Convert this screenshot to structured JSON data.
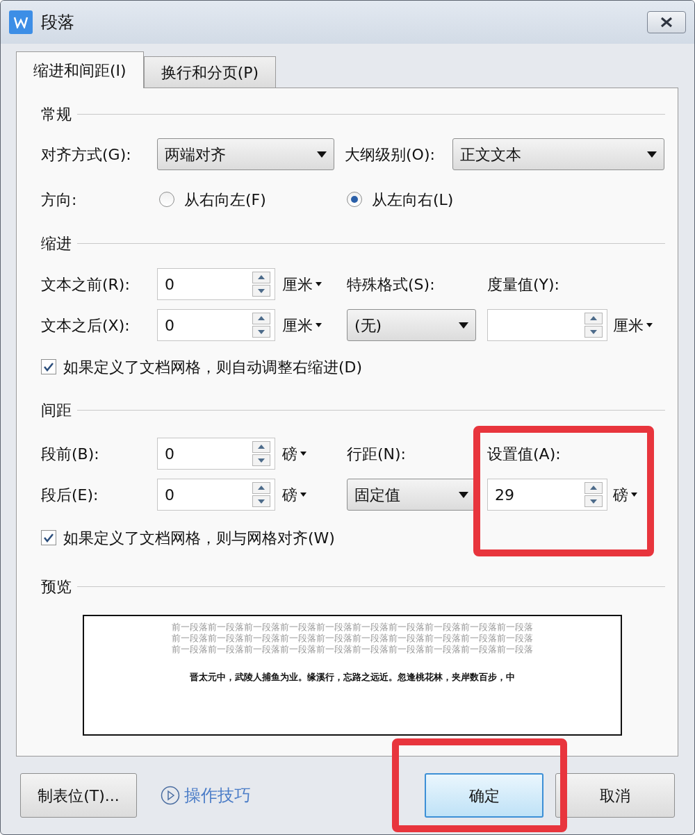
{
  "window": {
    "title": "段落"
  },
  "tabs": [
    {
      "label": "缩进和间距(I)",
      "selected": true
    },
    {
      "label": "换行和分页(P)",
      "selected": false
    }
  ],
  "general": {
    "heading": "常规",
    "alignment": {
      "label": "对齐方式(G):",
      "value": "两端对齐"
    },
    "outline_level": {
      "label": "大纲级别(O):",
      "value": "正文文本"
    },
    "direction": {
      "label": "方向:",
      "options": [
        {
          "label": "从右向左(F)",
          "selected": false
        },
        {
          "label": "从左向右(L)",
          "selected": true
        }
      ]
    }
  },
  "indent": {
    "heading": "缩进",
    "before": {
      "label": "文本之前(R):",
      "value": "0",
      "unit": "厘米"
    },
    "after": {
      "label": "文本之后(X):",
      "value": "0",
      "unit": "厘米"
    },
    "special": {
      "label": "特殊格式(S):",
      "value": "(无)"
    },
    "measure": {
      "label": "度量值(Y):",
      "unit": "厘米"
    },
    "grid_option": {
      "label": "如果定义了文档网格，则自动调整右缩进(D)",
      "checked": true
    }
  },
  "spacing": {
    "heading": "间距",
    "before": {
      "label": "段前(B):",
      "value": "0",
      "unit": "磅"
    },
    "after": {
      "label": "段后(E):",
      "value": "0",
      "unit": "磅"
    },
    "line_spacing": {
      "label": "行距(N):",
      "value": "固定值"
    },
    "set_value": {
      "label": "设置值(A):",
      "value": "29",
      "unit": "磅"
    },
    "grid_option": {
      "label": "如果定义了文档网格，则与网格对齐(W)",
      "checked": true
    }
  },
  "preview": {
    "heading": "预览",
    "previous_lines": [
      "前一段落前一段落前一段落前一段落前一段落前一段落前一段落前一段落前一段落前一段落",
      "前一段落前一段落前一段落前一段落前一段落前一段落前一段落前一段落前一段落前一段落",
      "前一段落前一段落前一段落前一段落前一段落前一段落前一段落前一段落前一段落前一段落"
    ],
    "sample": "晋太元中，武陵人捕鱼为业。缘溪行，忘路之远近。忽逢桃花林，夹岸数百步，中"
  },
  "buttons": {
    "tabs_button": "制表位(T)...",
    "tips_link": "操作技巧",
    "ok": "确定",
    "cancel": "取消"
  }
}
